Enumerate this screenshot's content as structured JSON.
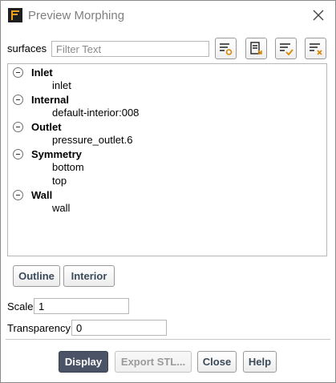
{
  "window": {
    "title": "Preview Morphing"
  },
  "surfaces": {
    "label": "surfaces",
    "filter_placeholder": "Filter Text",
    "filter_value": ""
  },
  "tree": {
    "groups": [
      {
        "label": "Inlet",
        "items": [
          "inlet"
        ]
      },
      {
        "label": "Internal",
        "items": [
          "default-interior:008"
        ]
      },
      {
        "label": "Outlet",
        "items": [
          "pressure_outlet.6"
        ]
      },
      {
        "label": "Symmetry",
        "items": [
          "bottom",
          "top"
        ]
      },
      {
        "label": "Wall",
        "items": [
          "wall"
        ]
      }
    ]
  },
  "view_buttons": {
    "outline": "Outline",
    "interior": "Interior"
  },
  "scale": {
    "label": "Scale",
    "value": "1"
  },
  "transparency": {
    "label": "Transparency",
    "value": "0"
  },
  "footer": {
    "display": "Display",
    "export_stl": "Export STL...",
    "close": "Close",
    "help": "Help"
  },
  "colors": {
    "primary_button": "#4a5466",
    "button_text": "#3c4a5a",
    "title_text": "#7f7f7f"
  },
  "icons": {
    "app": "fluent-app-icon",
    "close": "close-icon",
    "tools": [
      "filter-settings-icon",
      "select-flagged-icon",
      "select-all-icon",
      "deselect-all-icon"
    ]
  }
}
